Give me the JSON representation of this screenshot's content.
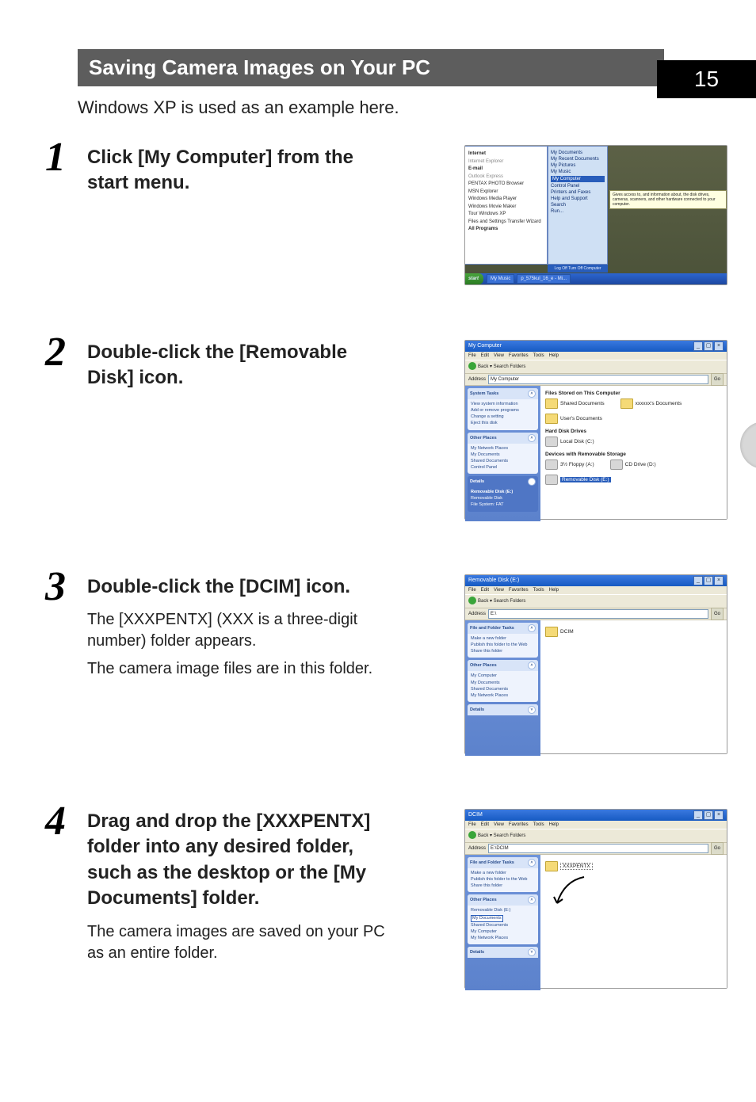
{
  "pageNumber": "15",
  "titleBar": "Saving Camera Images on Your PC",
  "intro": "Windows XP is used as an example here.",
  "steps": {
    "s1": {
      "num": "1",
      "head": "Click [My Computer] from the start menu."
    },
    "s2": {
      "num": "2",
      "head": "Double-click the [Removable Disk] icon."
    },
    "s3": {
      "num": "3",
      "head": "Double-click the [DCIM] icon.",
      "body1": "The [XXXPENTX] (XXX is a three-digit number) folder appears.",
      "body2": "The camera image files are in this folder."
    },
    "s4": {
      "num": "4",
      "head": "Drag and drop the [XXXPENTX] folder into any desired folder, such as the desktop or the [My Documents] folder.",
      "body1": "The camera images are saved on your PC as an entire folder."
    }
  },
  "shot1": {
    "leftItems": [
      "Internet",
      "Internet Explorer",
      "E-mail",
      "Outlook Express",
      "PENTAX PHOTO Browser",
      "MSN Explorer",
      "Windows Media Player",
      "Windows Movie Maker",
      "Tour Windows XP",
      "Files and Settings Transfer Wizard",
      "All Programs"
    ],
    "rightItems": [
      "My Documents",
      "My Recent Documents",
      "My Pictures",
      "My Music",
      "My Computer",
      "Control Panel",
      "Printers and Faxes",
      "Help and Support",
      "Search",
      "Run..."
    ],
    "selected": "My Computer",
    "tooltip": "Gives access to, and information about, the disk drives, cameras, scanners, and other hardware connected to your computer.",
    "logoff": "Log Off   Turn Off Computer",
    "taskbar": {
      "start": "start",
      "items": [
        "My Music",
        "p_575kul_16_e - Mi..."
      ]
    }
  },
  "shot2": {
    "title": "My Computer",
    "menu": [
      "File",
      "Edit",
      "View",
      "Favorites",
      "Tools",
      "Help"
    ],
    "toolbar": "Back  ▾      Search   Folders",
    "addressLabel": "Address",
    "addressValue": "My Computer",
    "go": "Go",
    "side": {
      "g1": {
        "title": "System Tasks",
        "items": [
          "View system information",
          "Add or remove programs",
          "Change a setting",
          "Eject this disk"
        ]
      },
      "g2": {
        "title": "Other Places",
        "items": [
          "My Network Places",
          "My Documents",
          "Shared Documents",
          "Control Panel"
        ]
      },
      "g3": {
        "title": "Details",
        "items": [
          "Removable Disk (E:)",
          "Removable Disk",
          "File System: FAT"
        ]
      }
    },
    "main": {
      "sec1": "Files Stored on This Computer",
      "row1": [
        "Shared Documents",
        "xxxxxx's Documents"
      ],
      "row1b": [
        "User's Documents"
      ],
      "sec2": "Hard Disk Drives",
      "row2": [
        "Local Disk (C:)"
      ],
      "sec3": "Devices with Removable Storage",
      "row3": [
        "3½ Floppy (A:)",
        "CD Drive (D:)"
      ],
      "row3sel": "Removable Disk (E:)"
    }
  },
  "shot3": {
    "title": "Removable Disk (E:)",
    "menu": [
      "File",
      "Edit",
      "View",
      "Favorites",
      "Tools",
      "Help"
    ],
    "toolbar": "Back  ▾      Search   Folders",
    "addressLabel": "Address",
    "addressValue": "E:\\",
    "go": "Go",
    "side": {
      "g1": {
        "title": "File and Folder Tasks",
        "items": [
          "Make a new folder",
          "Publish this folder to the Web",
          "Share this folder"
        ]
      },
      "g2": {
        "title": "Other Places",
        "items": [
          "My Computer",
          "My Documents",
          "Shared Documents",
          "My Network Places"
        ]
      },
      "g3": {
        "title": "Details",
        "items": []
      }
    },
    "main": {
      "folder": "DCIM"
    }
  },
  "shot4": {
    "title": "DCIM",
    "menu": [
      "File",
      "Edit",
      "View",
      "Favorites",
      "Tools",
      "Help"
    ],
    "toolbar": "Back  ▾      Search   Folders",
    "addressLabel": "Address",
    "addressValue": "E:\\DCIM",
    "go": "Go",
    "side": {
      "g1": {
        "title": "File and Folder Tasks",
        "items": [
          "Make a new folder",
          "Publish this folder to the Web",
          "Share this folder"
        ]
      },
      "g2": {
        "title": "Other Places",
        "items": [
          "Removable Disk (E:)",
          "My Documents",
          "Shared Documents",
          "My Computer",
          "My Network Places"
        ],
        "highlight": "My Documents"
      },
      "g3": {
        "title": "Details",
        "items": []
      }
    },
    "main": {
      "folder": "XXXPENTX"
    }
  }
}
